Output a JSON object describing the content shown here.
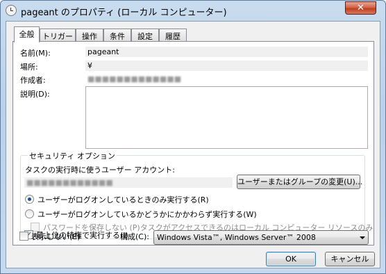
{
  "window": {
    "title": "pageant のプロパティ (ローカル コンピューター)",
    "close_glyph": "✕"
  },
  "tabs": [
    {
      "label": "全般"
    },
    {
      "label": "トリガー"
    },
    {
      "label": "操作"
    },
    {
      "label": "条件"
    },
    {
      "label": "設定"
    },
    {
      "label": "履歴"
    }
  ],
  "general": {
    "name_label": "名前(M):",
    "name_value": "pageant",
    "location_label": "場所:",
    "location_value": "¥",
    "author_label": "作成者:",
    "author_value": "(blurred)",
    "description_label": "説明(D):"
  },
  "security": {
    "group_title": "セキュリティ オプション",
    "account_label": "タスクの実行時に使うユーザー アカウント:",
    "account_value": "(blurred)",
    "change_user_button": "ユーザーまたはグループの変更(U)...",
    "radio_logged_on_only": "ユーザーがログオンしているときのみ実行する(R)",
    "radio_whether_logged_on": "ユーザーがログオンしているかどうかにかかわらず実行する(W)",
    "do_not_store_password": "パスワードを保存しない (P)タスクがアクセスできるのはローカル コンピューター リソースのみ",
    "run_highest_privileges": "最上位の特権で実行する(I)"
  },
  "footer": {
    "hidden_label": "表示しない(E)",
    "configure_label": "構成(C):",
    "configure_value": "Windows Vista™, Windows Server™ 2008",
    "ok_button": "OK",
    "cancel_button": "キャンセル"
  }
}
